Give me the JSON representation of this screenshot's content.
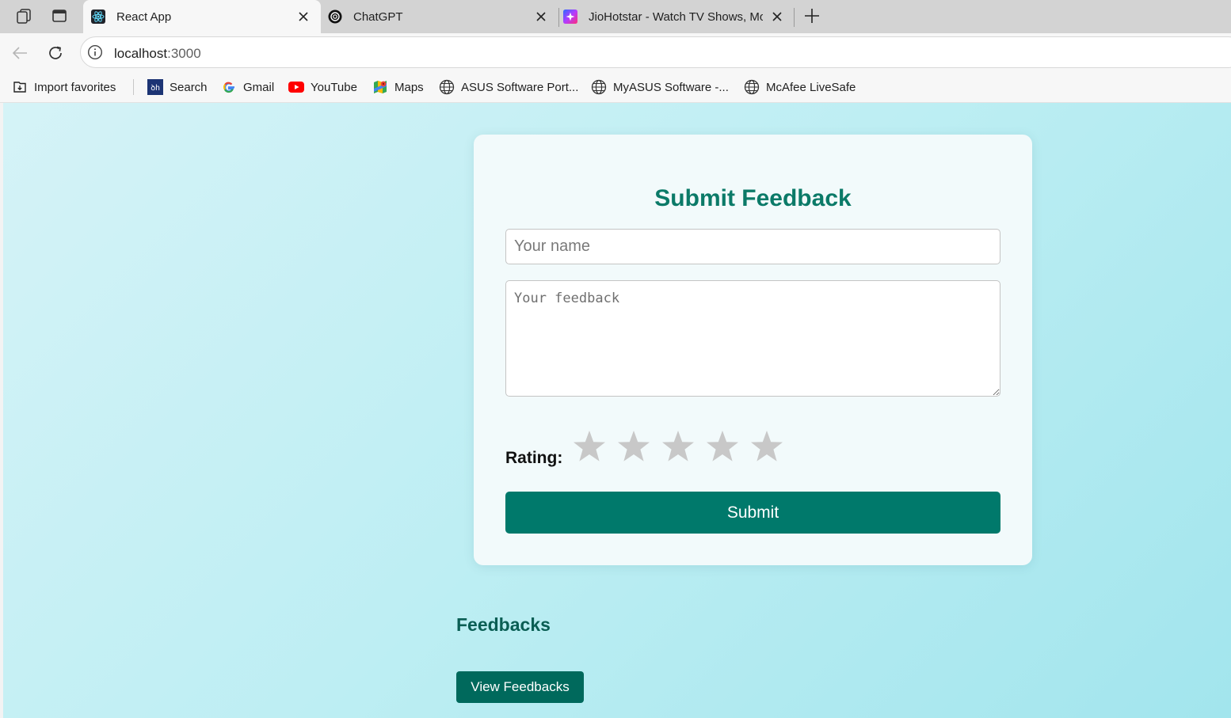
{
  "browser": {
    "tabs": [
      {
        "title": "React App",
        "favicon": "react-logo-icon",
        "active": true
      },
      {
        "title": "ChatGPT",
        "favicon": "chatgpt-logo-icon",
        "active": false
      },
      {
        "title": "JioHotstar - Watch TV Shows, Mo",
        "favicon": "jiohotstar-logo-icon",
        "active": false
      }
    ],
    "address": {
      "host": "localhost",
      "path": ":3000"
    },
    "bookmarks": [
      {
        "label": "Import favorites",
        "icon": "import-favorites-icon"
      },
      {
        "label": "Search",
        "icon": "search-bookmark-icon"
      },
      {
        "label": "Gmail",
        "icon": "google-g-icon"
      },
      {
        "label": "YouTube",
        "icon": "youtube-icon"
      },
      {
        "label": "Maps",
        "icon": "maps-icon"
      },
      {
        "label": "ASUS Software Port...",
        "icon": "globe-icon"
      },
      {
        "label": "MyASUS Software -...",
        "icon": "globe-icon"
      },
      {
        "label": "McAfee LiveSafe",
        "icon": "globe-icon"
      }
    ]
  },
  "page": {
    "form": {
      "title": "Submit Feedback",
      "name_placeholder": "Your name",
      "feedback_placeholder": "Your feedback",
      "rating_label": "Rating:",
      "rating": {
        "value": 0,
        "max": 5
      },
      "submit_label": "Submit"
    },
    "feedbacks": {
      "title": "Feedbacks",
      "view_button_label": "View Feedbacks"
    }
  },
  "colors": {
    "primary": "#00796b",
    "primary_dark": "#00695c",
    "title_teal": "#0b7a68",
    "star_empty": "#c8c8c8",
    "background_start": "#d5f3f7",
    "background_end": "#a2e5ed"
  }
}
